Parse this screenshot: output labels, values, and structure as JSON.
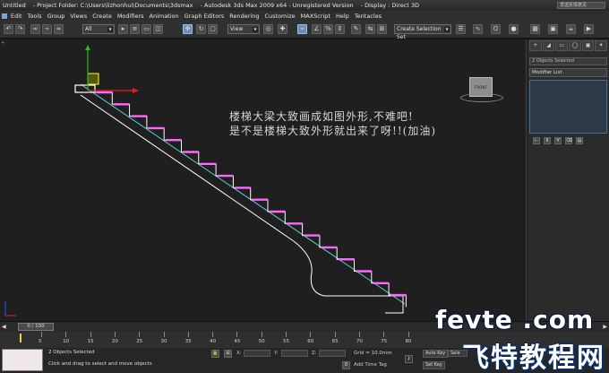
{
  "titlebar": {
    "doc": "Untitled",
    "project": "- Project Folder: C:\\Users\\lizhonhui\\Documents\\3dsmax",
    "app": "- Autodesk 3ds Max  2009 x64  - Unregistered Version",
    "display": "- Display : Direct 3D",
    "search_placeholder": "发送反馈意见"
  },
  "menubar": {
    "items": [
      "Edit",
      "Tools",
      "Group",
      "Views",
      "Create",
      "Modifiers",
      "Animation",
      "Graph Editors",
      "Rendering",
      "Customize",
      "MAXScript",
      "Help",
      "Tentacles"
    ]
  },
  "toolbar": {
    "filter_value": "All",
    "refcoord_value": "View",
    "selection_set_placeholder": "Create Selection Set"
  },
  "viewport": {
    "label": "+",
    "annotation_line1": "楼梯大梁大致画成如图外形,不难吧!",
    "annotation_line2": "是不是楼梯大致外形就出来了呀!!(加油)",
    "viewcube_label": "FRONT",
    "colors": {
      "stairs": "#ff66ff",
      "stringer": "#ffffff",
      "diagonal": "#5fd0d0",
      "gizmo_x": "#e02020",
      "gizmo_y": "#20c020",
      "gizmo_z": "#3050ff",
      "gizmo_box": "#ffff00"
    }
  },
  "cmdpanel": {
    "tabs": [
      "+",
      "◢",
      "▭",
      "◯",
      "▣",
      "✦"
    ],
    "object_name": "2 Objects Selected",
    "modifier_list": "Modifier List"
  },
  "timeline": {
    "slider_label": "0 / 100",
    "ruler_labels": [
      "5",
      "10",
      "15",
      "20",
      "25",
      "30",
      "35",
      "40",
      "45",
      "50",
      "55",
      "60",
      "65",
      "70",
      "75",
      "80"
    ]
  },
  "status": {
    "selected": "2 Objects Selected",
    "prompt": "Click and drag to select and move objects",
    "x_label": "X:",
    "y_label": "Y:",
    "z_label": "Z:",
    "grid": "Grid = 10.0mm",
    "add_time_tag": "Add Time Tag",
    "auto_key": "Auto Key",
    "set_key": "Set Key",
    "key_value": "Sele"
  },
  "watermark": {
    "domain": "fevte .com",
    "name": "飞特教程网"
  }
}
